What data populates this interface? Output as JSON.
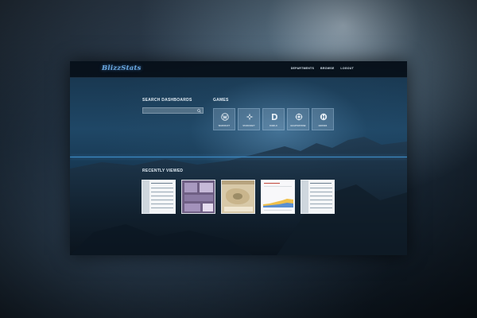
{
  "header": {
    "logo": "BlizzStats",
    "nav": [
      "DEPARTMENTS",
      "BROWSE",
      "LOGOUT"
    ]
  },
  "search": {
    "label": "SEARCH DASHBOARDS",
    "placeholder": ""
  },
  "games": {
    "label": "GAMES",
    "items": [
      {
        "name": "WARCRAFT",
        "icon": "warcraft-icon"
      },
      {
        "name": "STARCRAFT",
        "icon": "starcraft-icon"
      },
      {
        "name": "DIABLO",
        "icon": "diablo-icon"
      },
      {
        "name": "HEARTHSTONE",
        "icon": "hearthstone-icon"
      },
      {
        "name": "HEROES",
        "icon": "heroes-icon"
      }
    ]
  },
  "recent": {
    "label": "RECENTLY VIEWED",
    "thumbnails": [
      {
        "style": "table-light"
      },
      {
        "style": "purple-dashboard"
      },
      {
        "style": "tan-map"
      },
      {
        "style": "area-chart"
      },
      {
        "style": "table-light"
      }
    ]
  },
  "colors": {
    "accent": "#3d8ec9",
    "logo": "#6aa8e0"
  }
}
